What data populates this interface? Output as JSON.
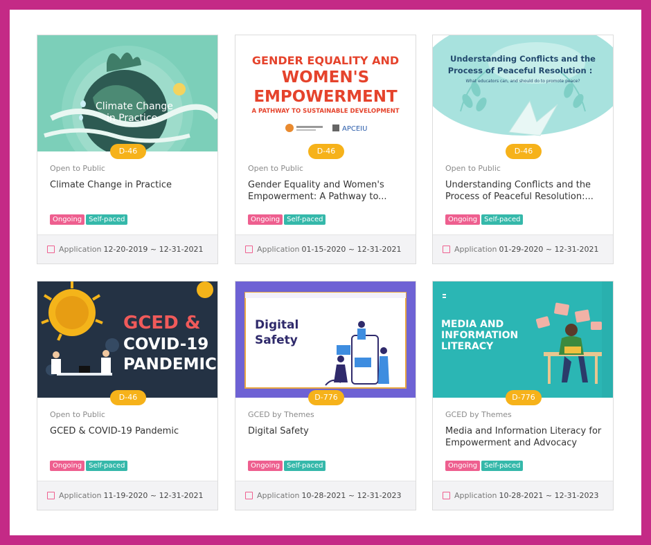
{
  "courses": [
    {
      "thumb_text": [
        "Climate Change",
        "in Practice"
      ],
      "days_left": "D-46",
      "category": "Open to Public",
      "title": "Climate Change in Practice",
      "status_tag": "Ongoing",
      "pace_tag": "Self-paced",
      "date_label": "Application",
      "date_range": "12-20-2019 ~ 12-31-2021"
    },
    {
      "thumb_text": [
        "GENDER EQUALITY AND",
        "WOMEN'S",
        "EMPOWERMENT",
        "A PATHWAY TO SUSTAINABLE DEVELOPMENT",
        "APCEIU"
      ],
      "days_left": "D-46",
      "category": "Open to Public",
      "title": "Gender Equality and Women's Empowerment: A Pathway to...",
      "status_tag": "Ongoing",
      "pace_tag": "Self-paced",
      "date_label": "Application",
      "date_range": "01-15-2020 ~ 12-31-2021"
    },
    {
      "thumb_text": [
        "Understanding Conflicts and the",
        "Process of Peaceful Resolution :",
        "What educators can, and should do to promote peace?"
      ],
      "days_left": "D-46",
      "category": "Open to Public",
      "title": "Understanding Conflicts and the Process of Peaceful Resolution:...",
      "status_tag": "Ongoing",
      "pace_tag": "Self-paced",
      "date_label": "Application",
      "date_range": "01-29-2020 ~ 12-31-2021"
    },
    {
      "thumb_text": [
        "GCED &",
        "COVID-19",
        "PANDEMIC"
      ],
      "days_left": "D-46",
      "category": "Open to Public",
      "title": "GCED & COVID-19 Pandemic",
      "status_tag": "Ongoing",
      "pace_tag": "Self-paced",
      "date_label": "Application",
      "date_range": "11-19-2020 ~ 12-31-2021"
    },
    {
      "thumb_text": [
        "Digital",
        "Safety"
      ],
      "days_left": "D-776",
      "category": "GCED by Themes",
      "title": "Digital Safety",
      "status_tag": "Ongoing",
      "pace_tag": "Self-paced",
      "date_label": "Application",
      "date_range": "10-28-2021 ~ 12-31-2023"
    },
    {
      "thumb_text": [
        "MEDIA AND",
        "INFORMATION",
        "LITERACY"
      ],
      "days_left": "D-776",
      "category": "GCED by Themes",
      "title": "Media and Information Literacy for Empowerment and Advocacy",
      "status_tag": "Ongoing",
      "pace_tag": "Self-paced",
      "date_label": "Application",
      "date_range": "10-28-2021 ~ 12-31-2023"
    }
  ]
}
